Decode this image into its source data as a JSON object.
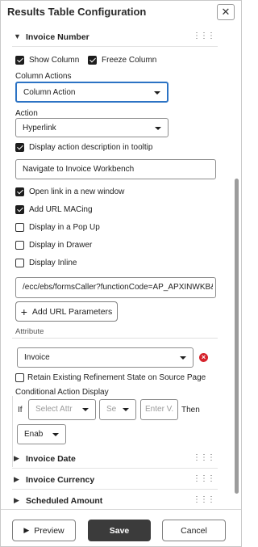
{
  "header": {
    "title": "Results Table Configuration",
    "close_label": "✕"
  },
  "invoice_number": {
    "section_label": "Invoice Number",
    "show_column": "Show Column",
    "freeze_column": "Freeze Column",
    "column_actions_label": "Column Actions",
    "column_actions_value": "Column Action",
    "action_label": "Action",
    "action_value": "Hyperlink",
    "tooltip_label": "Display action description in tooltip",
    "tooltip_value": "Navigate to Invoice Workbench",
    "open_new_window": "Open link in a new window",
    "add_url_macing": "Add URL MACing",
    "display_popup": "Display in a Pop Up",
    "display_drawer": "Display in Drawer",
    "display_inline": "Display Inline",
    "url_value": "/ecc/ebs/formsCaller?functionCode=AP_APXINWKB&",
    "add_url_params": "Add URL Parameters",
    "attribute_label": "Attribute",
    "attribute_value": "Invoice",
    "retain_state": "Retain Existing Refinement State on Source Page",
    "conditional_label": "Conditional Action Display",
    "if_label": "If",
    "select_attr_placeholder": "Select Attr",
    "operator_placeholder": "Se",
    "enter_value_placeholder": "Enter V.",
    "then_label": "Then",
    "then_value": "Enab"
  },
  "sections": [
    {
      "label": "Invoice Date"
    },
    {
      "label": "Invoice Currency"
    },
    {
      "label": "Scheduled Amount"
    }
  ],
  "footer": {
    "preview": "Preview",
    "save": "Save",
    "cancel": "Cancel"
  }
}
